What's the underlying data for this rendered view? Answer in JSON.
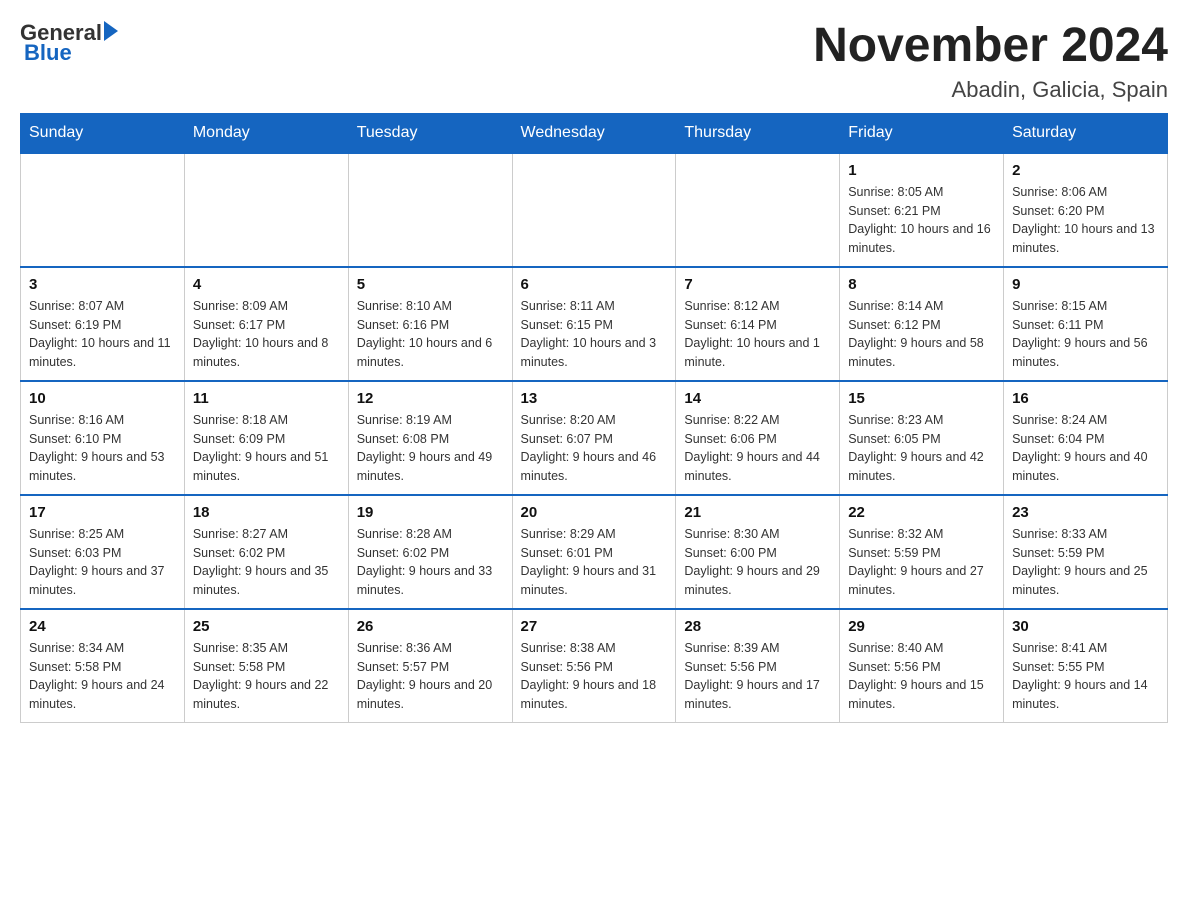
{
  "header": {
    "logo_general": "General",
    "logo_blue": "Blue",
    "month_title": "November 2024",
    "location": "Abadin, Galicia, Spain"
  },
  "weekdays": [
    "Sunday",
    "Monday",
    "Tuesday",
    "Wednesday",
    "Thursday",
    "Friday",
    "Saturday"
  ],
  "weeks": [
    [
      {
        "day": "",
        "info": ""
      },
      {
        "day": "",
        "info": ""
      },
      {
        "day": "",
        "info": ""
      },
      {
        "day": "",
        "info": ""
      },
      {
        "day": "",
        "info": ""
      },
      {
        "day": "1",
        "info": "Sunrise: 8:05 AM\nSunset: 6:21 PM\nDaylight: 10 hours and 16 minutes."
      },
      {
        "day": "2",
        "info": "Sunrise: 8:06 AM\nSunset: 6:20 PM\nDaylight: 10 hours and 13 minutes."
      }
    ],
    [
      {
        "day": "3",
        "info": "Sunrise: 8:07 AM\nSunset: 6:19 PM\nDaylight: 10 hours and 11 minutes."
      },
      {
        "day": "4",
        "info": "Sunrise: 8:09 AM\nSunset: 6:17 PM\nDaylight: 10 hours and 8 minutes."
      },
      {
        "day": "5",
        "info": "Sunrise: 8:10 AM\nSunset: 6:16 PM\nDaylight: 10 hours and 6 minutes."
      },
      {
        "day": "6",
        "info": "Sunrise: 8:11 AM\nSunset: 6:15 PM\nDaylight: 10 hours and 3 minutes."
      },
      {
        "day": "7",
        "info": "Sunrise: 8:12 AM\nSunset: 6:14 PM\nDaylight: 10 hours and 1 minute."
      },
      {
        "day": "8",
        "info": "Sunrise: 8:14 AM\nSunset: 6:12 PM\nDaylight: 9 hours and 58 minutes."
      },
      {
        "day": "9",
        "info": "Sunrise: 8:15 AM\nSunset: 6:11 PM\nDaylight: 9 hours and 56 minutes."
      }
    ],
    [
      {
        "day": "10",
        "info": "Sunrise: 8:16 AM\nSunset: 6:10 PM\nDaylight: 9 hours and 53 minutes."
      },
      {
        "day": "11",
        "info": "Sunrise: 8:18 AM\nSunset: 6:09 PM\nDaylight: 9 hours and 51 minutes."
      },
      {
        "day": "12",
        "info": "Sunrise: 8:19 AM\nSunset: 6:08 PM\nDaylight: 9 hours and 49 minutes."
      },
      {
        "day": "13",
        "info": "Sunrise: 8:20 AM\nSunset: 6:07 PM\nDaylight: 9 hours and 46 minutes."
      },
      {
        "day": "14",
        "info": "Sunrise: 8:22 AM\nSunset: 6:06 PM\nDaylight: 9 hours and 44 minutes."
      },
      {
        "day": "15",
        "info": "Sunrise: 8:23 AM\nSunset: 6:05 PM\nDaylight: 9 hours and 42 minutes."
      },
      {
        "day": "16",
        "info": "Sunrise: 8:24 AM\nSunset: 6:04 PM\nDaylight: 9 hours and 40 minutes."
      }
    ],
    [
      {
        "day": "17",
        "info": "Sunrise: 8:25 AM\nSunset: 6:03 PM\nDaylight: 9 hours and 37 minutes."
      },
      {
        "day": "18",
        "info": "Sunrise: 8:27 AM\nSunset: 6:02 PM\nDaylight: 9 hours and 35 minutes."
      },
      {
        "day": "19",
        "info": "Sunrise: 8:28 AM\nSunset: 6:02 PM\nDaylight: 9 hours and 33 minutes."
      },
      {
        "day": "20",
        "info": "Sunrise: 8:29 AM\nSunset: 6:01 PM\nDaylight: 9 hours and 31 minutes."
      },
      {
        "day": "21",
        "info": "Sunrise: 8:30 AM\nSunset: 6:00 PM\nDaylight: 9 hours and 29 minutes."
      },
      {
        "day": "22",
        "info": "Sunrise: 8:32 AM\nSunset: 5:59 PM\nDaylight: 9 hours and 27 minutes."
      },
      {
        "day": "23",
        "info": "Sunrise: 8:33 AM\nSunset: 5:59 PM\nDaylight: 9 hours and 25 minutes."
      }
    ],
    [
      {
        "day": "24",
        "info": "Sunrise: 8:34 AM\nSunset: 5:58 PM\nDaylight: 9 hours and 24 minutes."
      },
      {
        "day": "25",
        "info": "Sunrise: 8:35 AM\nSunset: 5:58 PM\nDaylight: 9 hours and 22 minutes."
      },
      {
        "day": "26",
        "info": "Sunrise: 8:36 AM\nSunset: 5:57 PM\nDaylight: 9 hours and 20 minutes."
      },
      {
        "day": "27",
        "info": "Sunrise: 8:38 AM\nSunset: 5:56 PM\nDaylight: 9 hours and 18 minutes."
      },
      {
        "day": "28",
        "info": "Sunrise: 8:39 AM\nSunset: 5:56 PM\nDaylight: 9 hours and 17 minutes."
      },
      {
        "day": "29",
        "info": "Sunrise: 8:40 AM\nSunset: 5:56 PM\nDaylight: 9 hours and 15 minutes."
      },
      {
        "day": "30",
        "info": "Sunrise: 8:41 AM\nSunset: 5:55 PM\nDaylight: 9 hours and 14 minutes."
      }
    ]
  ]
}
